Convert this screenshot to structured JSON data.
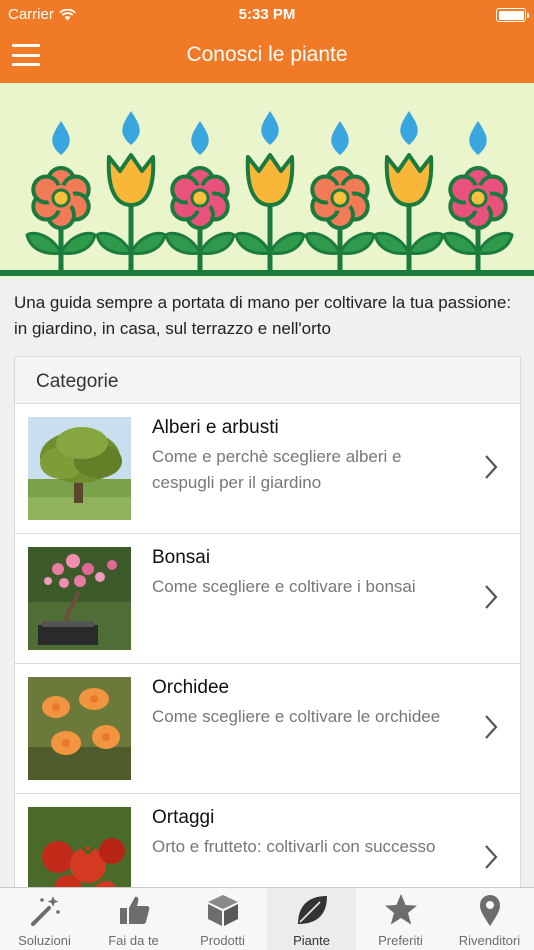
{
  "status_bar": {
    "carrier": "Carrier",
    "time": "5:33 PM",
    "wifi_icon": "wifi-icon",
    "battery_icon": "battery-full-icon"
  },
  "nav_bar": {
    "title": "Conosci le piante",
    "menu_icon": "hamburger-menu-icon"
  },
  "hero": {
    "background_color": "#eaf5cc",
    "ground_color": "#1b7a3e",
    "drop_color": "#3aa6e0",
    "flower_colors": [
      "#f27b57",
      "#f9b73a",
      "#e9527c",
      "#f9b73a",
      "#f27b57",
      "#f9b73a",
      "#e9527c"
    ]
  },
  "intro_text": "Una guida sempre a portata di mano per coltivare la tua passione: in giardino, in casa, sul terrazzo e nell'orto",
  "categories": {
    "header": "Categorie",
    "items": [
      {
        "name": "Alberi e arbusti",
        "description": "Come e perchè scegliere alberi e cespugli per il giardino",
        "thumbnail": "tree-photo"
      },
      {
        "name": "Bonsai",
        "description": "Come scegliere e coltivare i bonsai",
        "thumbnail": "bonsai-photo"
      },
      {
        "name": "Orchidee",
        "description": "Come scegliere e coltivare le orchidee",
        "thumbnail": "orchid-photo"
      },
      {
        "name": "Ortaggi",
        "description": "Orto e frutteto: coltivarli con successo",
        "thumbnail": "tomato-photo"
      }
    ]
  },
  "tab_bar": {
    "active": "Piante",
    "tabs": [
      {
        "label": "Soluzioni",
        "icon": "magic-wand-icon"
      },
      {
        "label": "Fai da te",
        "icon": "thumbs-up-icon"
      },
      {
        "label": "Prodotti",
        "icon": "box-icon"
      },
      {
        "label": "Piante",
        "icon": "leaf-icon"
      },
      {
        "label": "Preferiti",
        "icon": "star-icon"
      },
      {
        "label": "Rivenditori",
        "icon": "map-pin-icon"
      }
    ]
  },
  "colors": {
    "brand_orange": "#f07a26",
    "chevron": "#555555"
  }
}
